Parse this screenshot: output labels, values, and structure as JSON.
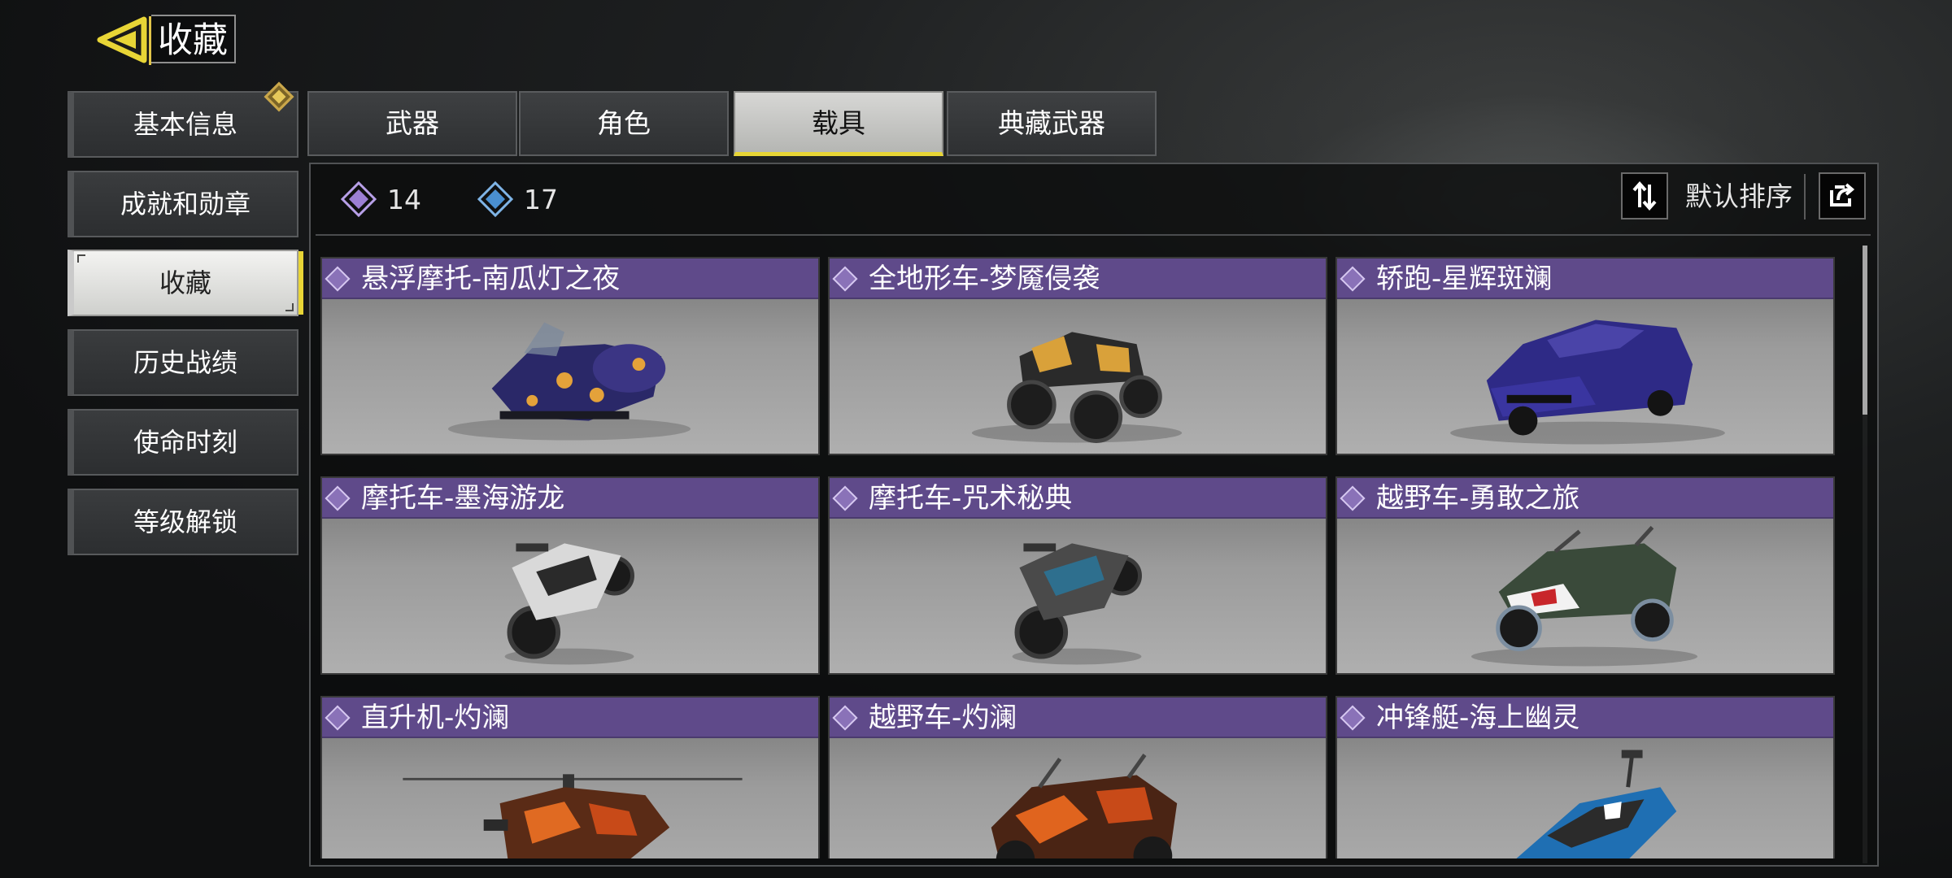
{
  "header": {
    "title": "收藏"
  },
  "sidebar": {
    "items": [
      {
        "label": "基本信息"
      },
      {
        "label": "成就和勋章"
      },
      {
        "label": "收藏"
      },
      {
        "label": "历史战绩"
      },
      {
        "label": "使命时刻"
      },
      {
        "label": "等级解锁"
      }
    ]
  },
  "tabs": [
    {
      "label": "武器"
    },
    {
      "label": "角色"
    },
    {
      "label": "载具"
    },
    {
      "label": "典藏武器"
    }
  ],
  "counts": {
    "purple": "14",
    "blue": "17"
  },
  "sort": {
    "label": "默认排序"
  },
  "cards": [
    {
      "title": "悬浮摩托-南瓜灯之夜"
    },
    {
      "title": "全地形车-梦魇侵袭"
    },
    {
      "title": "轿跑-星辉斑斓"
    },
    {
      "title": "摩托车-墨海游龙"
    },
    {
      "title": "摩托车-咒术秘典"
    },
    {
      "title": "越野车-勇敢之旅"
    },
    {
      "title": "直升机-灼澜"
    },
    {
      "title": "越野车-灼澜"
    },
    {
      "title": "冲锋艇-海上幽灵"
    }
  ],
  "colors": {
    "accent_yellow": "#e8d536",
    "rarity_purple": "#5f4a8a",
    "count_purple": "#9c7fd4",
    "count_blue": "#4a8fd0"
  }
}
